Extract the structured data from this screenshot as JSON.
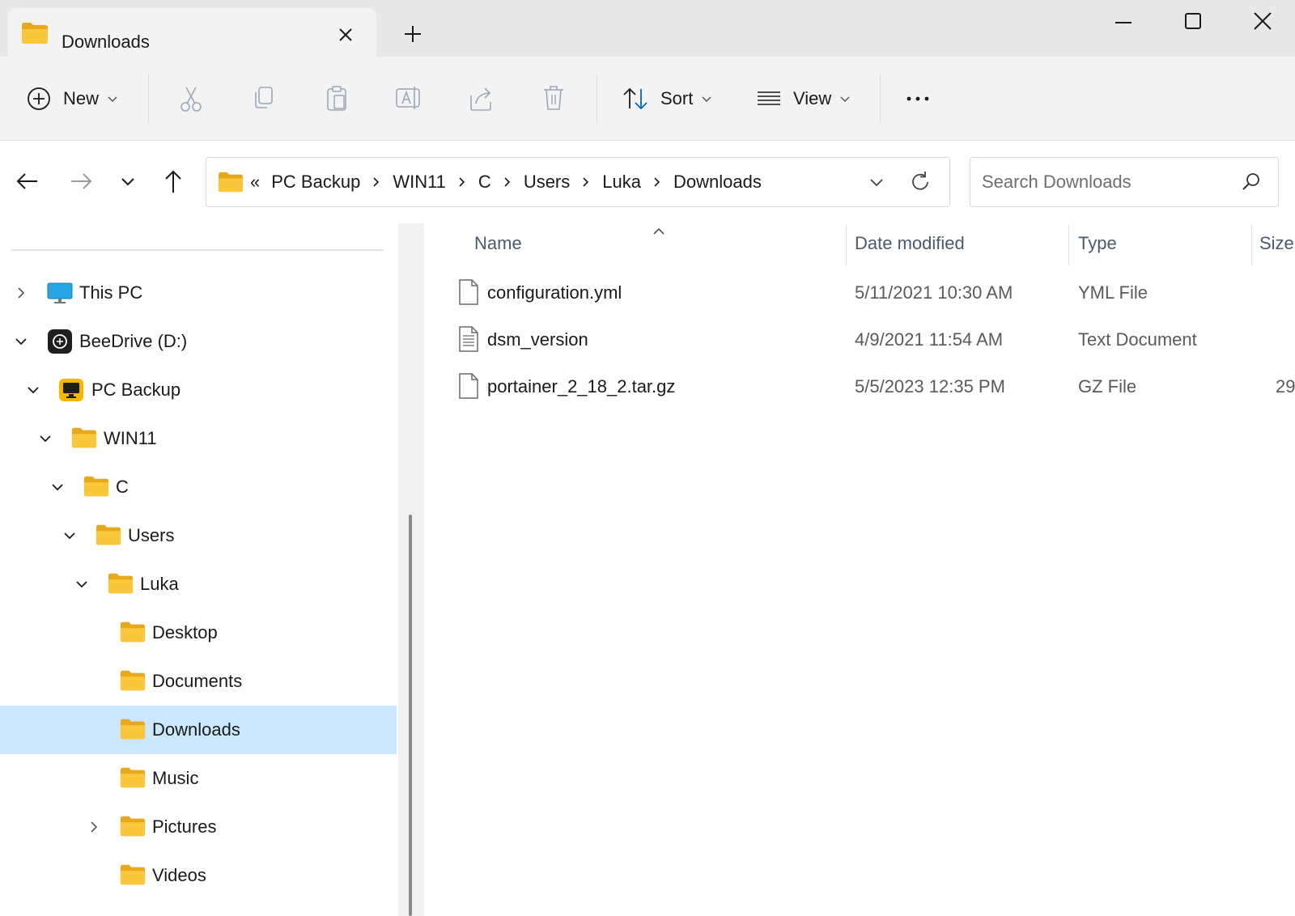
{
  "window": {
    "tab_title": "Downloads",
    "controls": {
      "minimize": "minimize-icon",
      "maximize": "maximize-icon",
      "close": "close-icon"
    }
  },
  "toolbar": {
    "new_label": "New",
    "sort_label": "Sort",
    "view_label": "View",
    "icons": [
      "cut-icon",
      "copy-icon",
      "paste-icon",
      "rename-icon",
      "share-icon",
      "delete-icon",
      "more-icon"
    ]
  },
  "address": {
    "overflow": "«",
    "crumbs": [
      "PC Backup",
      "WIN11",
      "C",
      "Users",
      "Luka",
      "Downloads"
    ]
  },
  "search": {
    "placeholder": "Search Downloads"
  },
  "sidebar": {
    "items": [
      {
        "label": "This PC",
        "expanded": false
      },
      {
        "label": "BeeDrive (D:)",
        "expanded": true
      },
      {
        "label": "PC Backup",
        "expanded": true
      },
      {
        "label": "WIN11",
        "expanded": true
      },
      {
        "label": "C",
        "expanded": true
      },
      {
        "label": "Users",
        "expanded": true
      },
      {
        "label": "Luka",
        "expanded": true
      },
      {
        "label": "Desktop"
      },
      {
        "label": "Documents"
      },
      {
        "label": "Downloads",
        "selected": true
      },
      {
        "label": "Music"
      },
      {
        "label": "Pictures",
        "expanded": false
      },
      {
        "label": "Videos"
      }
    ]
  },
  "filelist": {
    "columns": {
      "name": "Name",
      "date": "Date modified",
      "type": "Type",
      "size": "Size"
    },
    "rows": [
      {
        "name": "configuration.yml",
        "date": "5/11/2021 10:30 AM",
        "type": "YML File",
        "size": ""
      },
      {
        "name": "dsm_version",
        "date": "4/9/2021 11:54 AM",
        "type": "Text Document",
        "size": ""
      },
      {
        "name": "portainer_2_18_2.tar.gz",
        "date": "5/5/2023 12:35 PM",
        "type": "GZ File",
        "size": "29"
      }
    ]
  },
  "colors": {
    "accent": "#0067c0",
    "selection": "#cce8ff",
    "folder": "#f8c73b"
  }
}
